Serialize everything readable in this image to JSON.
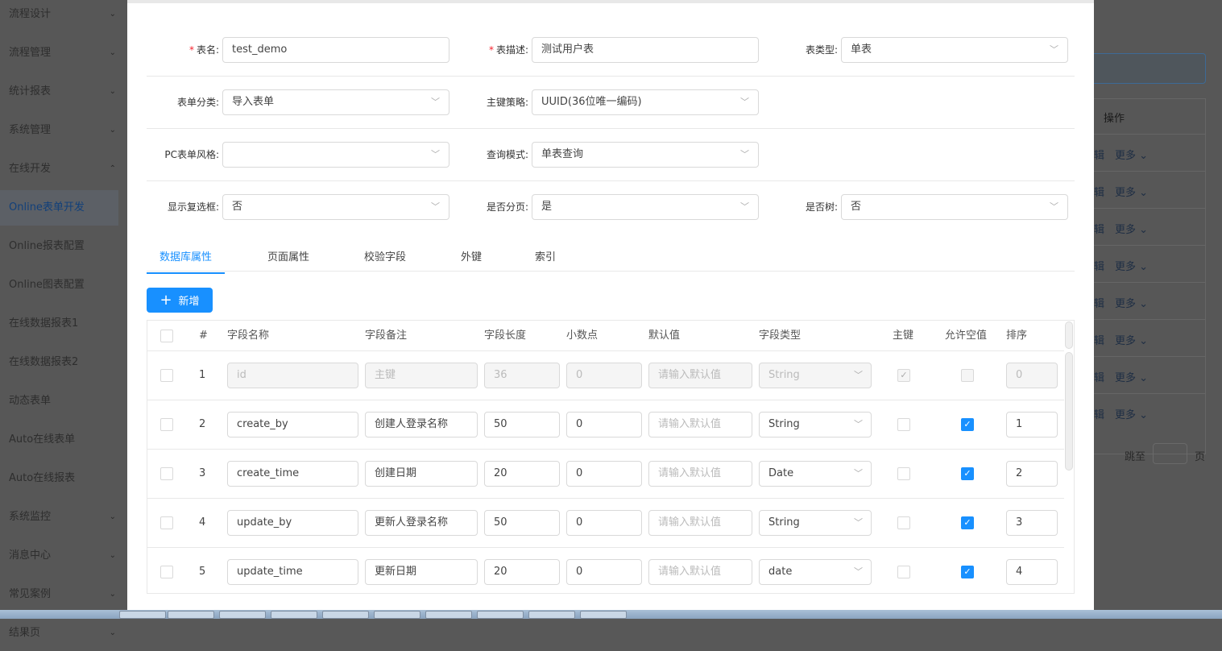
{
  "sidebar": {
    "items": [
      {
        "label": "流程设计",
        "chev": "⌄"
      },
      {
        "label": "流程管理",
        "chev": "⌄"
      },
      {
        "label": "统计报表",
        "chev": "⌄"
      },
      {
        "label": "系统管理",
        "chev": "⌄"
      },
      {
        "label": "在线开发",
        "chev": "⌃"
      },
      {
        "label": "Online表单开发",
        "active": true
      },
      {
        "label": "Online报表配置"
      },
      {
        "label": "Online图表配置"
      },
      {
        "label": "在线数据报表1"
      },
      {
        "label": "在线数据报表2"
      },
      {
        "label": "动态表单"
      },
      {
        "label": "Auto在线表单"
      },
      {
        "label": "Auto在线报表"
      },
      {
        "label": "系统监控",
        "chev": "⌄"
      },
      {
        "label": "消息中心",
        "chev": "⌄"
      },
      {
        "label": "常见案例",
        "chev": "⌄"
      },
      {
        "label": "结果页",
        "chev": "⌄"
      }
    ]
  },
  "background": {
    "op_header": "操作",
    "edit": "辑",
    "more": "更多 ⌄",
    "jump": "跳至",
    "page": "页"
  },
  "form": {
    "table_name": {
      "label": "表名:",
      "value": "test_demo"
    },
    "table_desc": {
      "label": "表描述:",
      "value": "测试用户表"
    },
    "table_type": {
      "label": "表类型:",
      "value": "单表"
    },
    "form_category": {
      "label": "表单分类:",
      "value": "导入表单"
    },
    "pk_strategy": {
      "label": "主键策略:",
      "value": "UUID(36位唯一编码)"
    },
    "pc_style": {
      "label": "PC表单风格:",
      "value": ""
    },
    "query_mode": {
      "label": "查询模式:",
      "value": "单表查询"
    },
    "show_checkbox": {
      "label": "显示复选框:",
      "value": "否"
    },
    "paging": {
      "label": "是否分页:",
      "value": "是"
    },
    "is_tree": {
      "label": "是否树:",
      "value": "否"
    },
    "required_mark": "*"
  },
  "tabs": [
    "数据库属性",
    "页面属性",
    "校验字段",
    "外键",
    "索引"
  ],
  "add_button": "新增",
  "add_icon": "+",
  "table": {
    "headers": [
      "#",
      "字段名称",
      "字段备注",
      "字段长度",
      "小数点",
      "默认值",
      "字段类型",
      "主键",
      "允许空值",
      "排序"
    ],
    "default_placeholder": "请输入默认值",
    "rows": [
      {
        "n": "1",
        "name": "id",
        "remark": "主键",
        "length": "36",
        "decimal": "0",
        "type": "String",
        "pk": true,
        "nullable": false,
        "order": "0",
        "disabled": true
      },
      {
        "n": "2",
        "name": "create_by",
        "remark": "创建人登录名称",
        "length": "50",
        "decimal": "0",
        "type": "String",
        "pk": false,
        "nullable": true,
        "order": "1"
      },
      {
        "n": "3",
        "name": "create_time",
        "remark": "创建日期",
        "length": "20",
        "decimal": "0",
        "type": "Date",
        "pk": false,
        "nullable": true,
        "order": "2"
      },
      {
        "n": "4",
        "name": "update_by",
        "remark": "更新人登录名称",
        "length": "50",
        "decimal": "0",
        "type": "String",
        "pk": false,
        "nullable": true,
        "order": "3"
      },
      {
        "n": "5",
        "name": "update_time",
        "remark": "更新日期",
        "length": "20",
        "decimal": "0",
        "type": "date",
        "pk": false,
        "nullable": true,
        "order": "4"
      }
    ]
  }
}
